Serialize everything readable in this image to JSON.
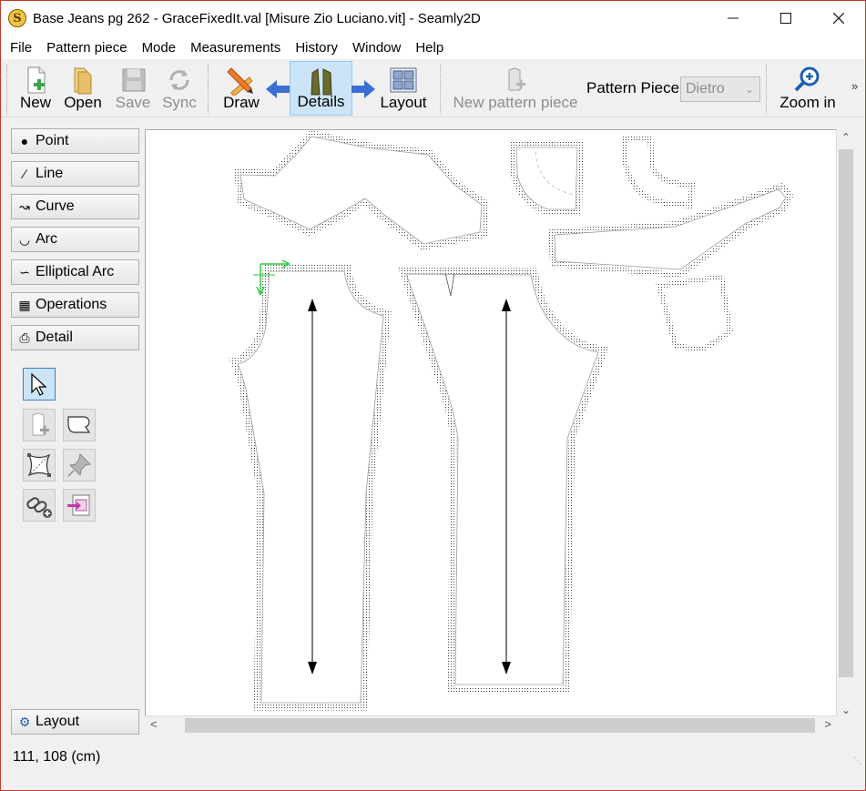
{
  "window": {
    "title": "Base Jeans pg 262 - GraceFixedIt.val [Misure Zio Luciano.vit] - Seamly2D",
    "app_icon_glyph": "S"
  },
  "menu": [
    "File",
    "Pattern piece",
    "Mode",
    "Measurements",
    "History",
    "Window",
    "Help"
  ],
  "toolbar": {
    "new": "New",
    "open": "Open",
    "save": "Save",
    "sync": "Sync",
    "draw": "Draw",
    "details": "Details",
    "layout": "Layout",
    "new_pattern_piece": "New pattern piece",
    "pattern_piece_label": "Pattern Piece:",
    "pattern_piece_value": "Dietro",
    "zoom_in": "Zoom in",
    "more": "»"
  },
  "tools": {
    "point": "Point",
    "line": "Line",
    "curve": "Curve",
    "arc": "Arc",
    "elliptical_arc": "Elliptical Arc",
    "operations": "Operations",
    "detail": "Detail",
    "layout": "Layout"
  },
  "status": {
    "coordinates": "111, 108 (cm)"
  },
  "colors": {
    "accent": "#3a7fc1",
    "details_active_bg": "#cce4f7",
    "arrow_blue": "#3b6fd6",
    "anchor_green": "#2ecc40"
  }
}
